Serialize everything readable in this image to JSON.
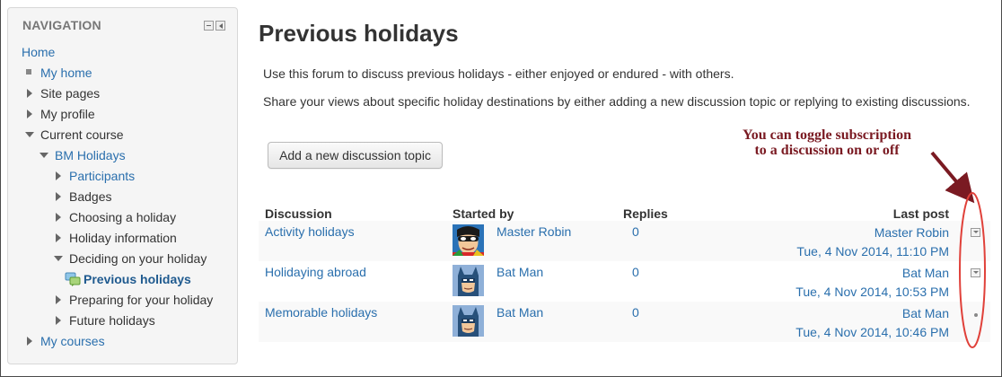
{
  "navigation": {
    "header": "NAVIGATION",
    "items": [
      {
        "label": "Home"
      },
      {
        "label": "My home"
      },
      {
        "label": "Site pages"
      },
      {
        "label": "My profile"
      },
      {
        "label": "Current course"
      },
      {
        "label": "BM Holidays"
      },
      {
        "label": "Participants"
      },
      {
        "label": "Badges"
      },
      {
        "label": "Choosing a holiday"
      },
      {
        "label": "Holiday information"
      },
      {
        "label": "Deciding on your holiday"
      },
      {
        "label": "Previous holidays"
      },
      {
        "label": "Preparing for your holiday"
      },
      {
        "label": "Future holidays"
      },
      {
        "label": "My courses"
      }
    ]
  },
  "main": {
    "title": "Previous holidays",
    "intro_1": "Use this forum to discuss previous holidays - either enjoyed or endured - with others.",
    "intro_2": "Share your views about specific holiday destinations by either adding a new discussion topic or replying to existing discussions.",
    "add_button": "Add a new discussion topic",
    "table": {
      "headers": {
        "discussion": "Discussion",
        "started_by": "Started by",
        "replies": "Replies",
        "last_post": "Last post"
      },
      "rows": [
        {
          "discussion": "Activity holidays",
          "started_by": "Master Robin",
          "avatar": "robin-avatar",
          "replies": "0",
          "last_author": "Master Robin",
          "last_date": "Tue, 4 Nov 2014, 11:10 PM",
          "subscription": "toggle"
        },
        {
          "discussion": "Holidaying abroad",
          "started_by": "Bat Man",
          "avatar": "batman-avatar",
          "replies": "0",
          "last_author": "Bat Man",
          "last_date": "Tue, 4 Nov 2014, 10:53 PM",
          "subscription": "toggle"
        },
        {
          "discussion": "Memorable holidays",
          "started_by": "Bat Man",
          "avatar": "batman-avatar",
          "replies": "0",
          "last_author": "Bat Man",
          "last_date": "Tue, 4 Nov 2014, 10:46 PM",
          "subscription": "dot"
        }
      ]
    }
  },
  "annotation": {
    "line_1": "You can toggle subscription",
    "line_2": "to a discussion on or off",
    "color": "#7a1a22",
    "ellipse_color": "#e0413a"
  },
  "colors": {
    "link": "#2a6fad",
    "nav_bg": "#f5f5f5"
  }
}
